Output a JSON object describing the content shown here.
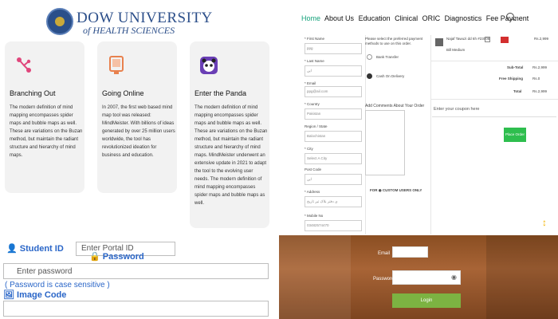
{
  "brand": {
    "title": "DOW UNIVERSITY",
    "subtitle": "of HEALTH SCIENCES"
  },
  "features": [
    {
      "title": "Branching Out",
      "text": "The modern definition of mind mapping encompasses spider maps and bubble maps as well. These are variations on the Buzan method, but maintain the radiant structure and hierarchy of mind maps.",
      "icon": "branch-icon",
      "color": "#e0467c"
    },
    {
      "title": "Going Online",
      "text": "In 2007, the first web based mind map tool was released: MindMeister. With billions of ideas generated by over 25 million users worldwide, the tool has revolutionized ideation for business and education.",
      "icon": "monitor-icon",
      "color": "#e8814e"
    },
    {
      "title": "Enter the Panda",
      "text": "The modern definition of mind mapping encompasses spider maps and bubble maps as well. These are variations on the Buzan method, but maintain the radiant structure and hierarchy of mind maps. MindMeister underwent an extensive update in 2021 to adapt the tool to the evolving user needs. The modern definition of mind mapping encompasses spider maps and bubble maps as well.",
      "icon": "panda-icon",
      "color": "#6a3fb5"
    }
  ],
  "nav": {
    "items": [
      "Home",
      "About Us",
      "Education",
      "Clinical",
      "ORIC",
      "Diagnostics",
      "Fee Payment"
    ],
    "active": "Home"
  },
  "checkout": {
    "fields": [
      {
        "label": "* First Name",
        "value": "ppg"
      },
      {
        "label": "* Last Name",
        "value": "ایں"
      },
      {
        "label": "* Email",
        "value": "ppg@ail.com"
      },
      {
        "label": "* Country",
        "value": "Pakistan"
      },
      {
        "label": "Region / State",
        "value": "Balochistan"
      },
      {
        "label": "* City",
        "value": "Select A City"
      },
      {
        "label": "Post Code",
        "value": "ایں"
      },
      {
        "label": "* Address",
        "value": "ی دفتر بلاک تیر تاریخ"
      },
      {
        "label": "* Mobile No",
        "value": "03482574470"
      }
    ],
    "payment_prompt": "Please select the preferred payment methods to use on this order.",
    "payment_options": [
      "Bank Transfer",
      "Cash On Delivery"
    ],
    "comment_label": "Add Comments About Your Order",
    "foreign_label": "FOR ◉ CUSTOM USERS ONLY",
    "product": {
      "name": "Najaf Tawuzi dd 6h #23006",
      "sub": "Bill Medium",
      "price": "Rs.2,999"
    },
    "totals": [
      {
        "label": "Sub-Total",
        "value": "Rs.2,999"
      },
      {
        "label": "Free Shipping",
        "value": "Rs.0"
      },
      {
        "label": "Total",
        "value": "Rs.2,999"
      }
    ],
    "coupon_placeholder": "Enter your coupon here",
    "place_order": "Place Order"
  },
  "portal": {
    "student_id_label": "Student ID",
    "portal_id_placeholder": "Enter Portal ID",
    "password_label": "Password",
    "password_placeholder": "Enter password",
    "case_note": "( Password is case sensitive )",
    "image_code_label": "Image Code"
  },
  "login": {
    "email_label": "Email",
    "password_label": "Password",
    "button": "Login"
  }
}
